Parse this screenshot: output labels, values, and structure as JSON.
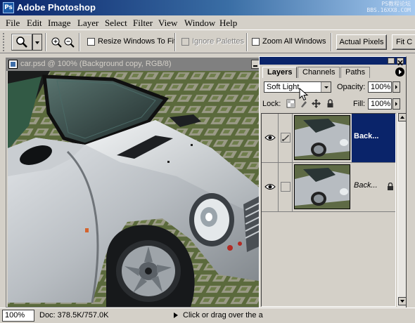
{
  "app": {
    "title": "Adobe Photoshop",
    "watermark_line1": "PS教程论坛",
    "watermark_line2": "BBS.16XX8.COM"
  },
  "menu": [
    "File",
    "Edit",
    "Image",
    "Layer",
    "Select",
    "Filter",
    "View",
    "Window",
    "Help"
  ],
  "options_bar": {
    "resize_windows_label": "Resize Windows To Fit",
    "ignore_palettes_label": "Ignore Palettes",
    "zoom_all_windows_label": "Zoom All Windows",
    "actual_pixels_label": "Actual Pixels",
    "fit_on_screen_label": "Fit C"
  },
  "document": {
    "title": "car.psd @ 100% (Background copy, RGB/8)"
  },
  "layers_panel": {
    "tabs": [
      "Layers",
      "Channels",
      "Paths"
    ],
    "active_tab": "Layers",
    "blend_mode": "Soft Light",
    "opacity_label": "Opacity:",
    "opacity_value": "100%",
    "lock_label": "Lock:",
    "fill_label": "Fill:",
    "fill_value": "100%",
    "layers": [
      {
        "name": "Back...",
        "selected": true
      },
      {
        "name": "Back...",
        "selected": false,
        "italic": true,
        "locked": true
      }
    ]
  },
  "status": {
    "zoom": "100%",
    "doc_size": "Doc: 378.5K/757.0K",
    "hint": "Click or drag over the a"
  },
  "colors": {
    "titlebar_start": "#0a246a",
    "titlebar_end": "#a6caf0",
    "chrome": "#d4d0c8",
    "selection": "#0a246a"
  }
}
